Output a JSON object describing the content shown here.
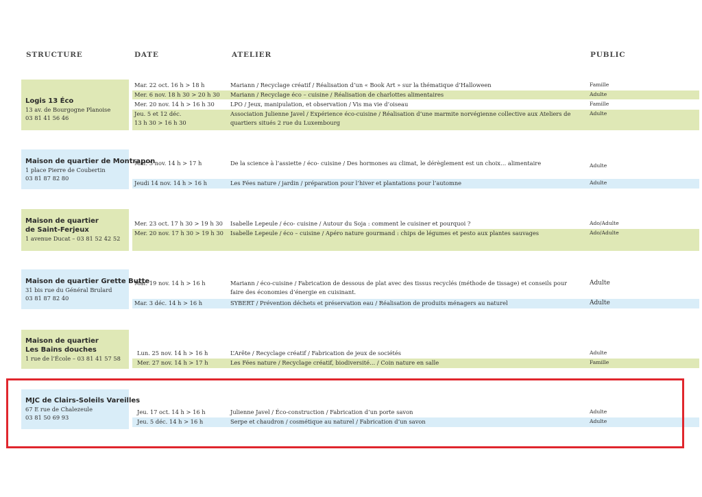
{
  "headers": {
    "structure": "STRUCTURE",
    "date": "DATE",
    "atelier": "ATELIER",
    "public": "PUBLIC"
  },
  "colors": {
    "green_band": "#dfe8b6",
    "blue_band": "#d9edf8",
    "highlight_border": "#e0262d"
  },
  "blocks": [
    {
      "name": "Logis 13 Éco",
      "lines": [
        "13 av. de Bourgogne Planoise",
        "03 81 41 56 46"
      ],
      "rows": [
        {
          "date": "Mar. 22 oct. 16 h > 18 h",
          "atelier": "Mariann / Recyclage créatif / Réalisation d’un « Book Art » sur la thématique d’Halloween",
          "public": "Famille"
        },
        {
          "date": "Mer. 6 nov. 18 h 30 > 20 h 30",
          "atelier": "Mariann / Recyclage éco – cuisine / Réalisation de charlottes alimentaires",
          "public": "Adulte"
        },
        {
          "date": "Mer. 20 nov. 14 h > 16 h 30",
          "atelier": "LPO / Jeux, manipulation, et observation / Vis ma vie d’oiseau",
          "public": "Famille"
        },
        {
          "date": "Jeu. 5 et 12 déc.",
          "date2": "13 h 30 > 16 h 30",
          "atelier": "Association Julienne Javel / Expérience éco-cuisine / Réalisation d’une marmite norvégienne collective aux Ateliers de quartiers situés 2 rue du Luxembourg",
          "public": "Adulte"
        }
      ]
    },
    {
      "name": "Maison de quartier de Montrapon",
      "lines": [
        "1 place Pierre de Coubertin",
        "03 81 87 82 80"
      ],
      "rows": [
        {
          "date": "Mar. 5 nov. 14 h > 17 h",
          "atelier": "De la science à l’assiette / éco- cuisine / Des hormones au climat, le dérèglement est un choix… alimentaire",
          "public": "Adulte"
        },
        {
          "date": "Jeudi 14 nov. 14 h > 16 h",
          "atelier": "Les Fées nature / jardin / préparation pour l’hiver et plantations pour l’automne",
          "public": "Adulte"
        }
      ]
    },
    {
      "name_lines": [
        "Maison de quartier",
        "de Saint-Ferjeux"
      ],
      "lines": [
        "1 avenue Ducat – 03 81 52 42 52"
      ],
      "rows": [
        {
          "date": "Mer. 23 oct. 17 h 30 > 19 h 30",
          "atelier": "Isabelle Lepeule / éco- cuisine / Autour du Soja : comment le cuisiner et pourquoi ?",
          "public": "Ado/Adulte"
        },
        {
          "date": "Mer. 20 nov. 17 h 30 > 19 h 30",
          "atelier": "Isabelle Lepeule / éco – cuisine / Apéro nature gourmand : chips de légumes et pesto aux plantes sauvages",
          "public": "Ado/Adulte"
        }
      ]
    },
    {
      "name": "Maison de quartier Grette Butte",
      "lines": [
        "31 bis rue du Général Brulard",
        "03 81 87 82 40"
      ],
      "rows": [
        {
          "date": "Mar. 19 nov. 14 h > 16 h",
          "atelier": "Mariann / éco-cuisine / Fabrication de dessous de plat avec des tissus recyclés (méthode de tissage) et conseils pour faire des économies d’énergie en cuisinant.",
          "public": "Adulte"
        },
        {
          "date": "Mar. 3 déc. 14 h > 16 h",
          "atelier": "SYBERT / Prévention déchets et préservation eau / Réalisation de produits ménagers au naturel",
          "public": "Adulte"
        }
      ]
    },
    {
      "name_lines": [
        "Maison de quartier",
        "Les Bains douches"
      ],
      "lines": [
        "1 rue de l’École – 03 81 41 57 58"
      ],
      "rows": [
        {
          "date": "Lun. 25 nov. 14 h > 16 h",
          "atelier": "L’Arête / Recyclage créatif / Fabrication de jeux de sociétés",
          "public": "Adulte"
        },
        {
          "date": "Mer. 27 nov. 14 h > 17 h",
          "atelier": "Les Fées nature / Recyclage créatif, biodiversité… / Coin nature en salle",
          "public": "Famille"
        }
      ]
    },
    {
      "name": "MJC de Clairs-Soleils Vareilles",
      "lines": [
        "67 E rue de Chalezeule",
        "03 81 50 69 93"
      ],
      "rows": [
        {
          "date": "Jeu. 17 oct. 14 h > 16 h",
          "atelier": "Julienne Javel / Éco-construction / Fabrication d’un porte savon",
          "public": "Adulte"
        },
        {
          "date": "Jeu. 5 déc. 14 h > 16 h",
          "atelier": "Serpe et chaudron / cosmétique au naturel / Fabrication d’un savon",
          "public": "Adulte"
        }
      ]
    }
  ]
}
